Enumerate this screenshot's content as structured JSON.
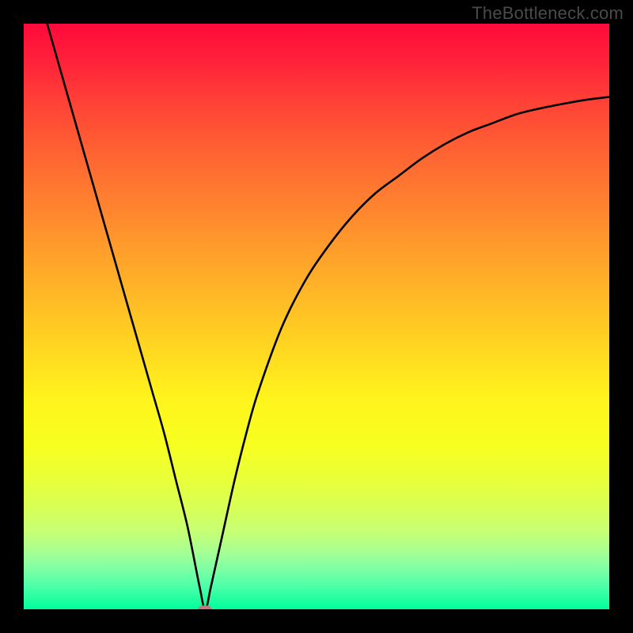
{
  "watermark": "TheBottleneck.com",
  "colors": {
    "frame": "#000000",
    "curve": "#000000",
    "marker": "#c9757a"
  },
  "chart_data": {
    "type": "line",
    "title": "",
    "xlabel": "",
    "ylabel": "",
    "xlim": [
      0,
      100
    ],
    "ylim": [
      0,
      100
    ],
    "x": [
      4,
      6,
      8,
      10,
      12,
      14,
      16,
      18,
      20,
      22,
      24,
      26,
      28,
      30,
      31,
      32,
      34,
      36,
      38,
      40,
      44,
      48,
      52,
      56,
      60,
      64,
      68,
      72,
      76,
      80,
      84,
      88,
      92,
      96,
      100
    ],
    "values": [
      100,
      93,
      86,
      79,
      72,
      65,
      58,
      51,
      44,
      37,
      30,
      22,
      14,
      4,
      0,
      4,
      13,
      22,
      30,
      37,
      48,
      56,
      62,
      67,
      71,
      74,
      77,
      79.5,
      81.5,
      83,
      84.5,
      85.5,
      86.3,
      87,
      87.5
    ],
    "marker": {
      "x": 31,
      "y": 0
    },
    "background_gradient": {
      "top": "#ff0a3a",
      "mid": "#ffd222",
      "bottom": "#00ff9c"
    }
  }
}
